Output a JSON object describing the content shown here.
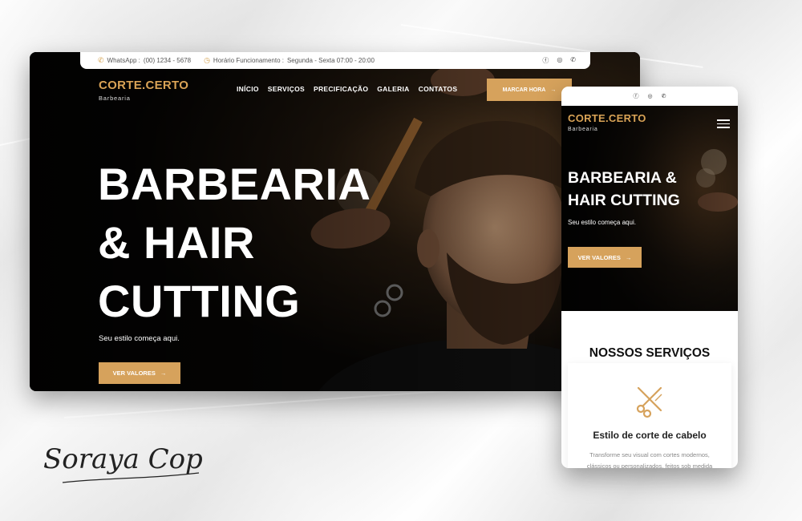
{
  "colors": {
    "gold": "#d6a25c",
    "dark": "#0d0b08",
    "white": "#ffffff"
  },
  "topbar": {
    "whatsapp_label": "WhatsApp :",
    "whatsapp_number": "(00) 1234 - 5678",
    "hours_label": "Horário Funcionamento :",
    "hours_value": "Segunda - Sexta 07:00 - 20:00",
    "icons": [
      "phone-icon",
      "clock-icon",
      "facebook-icon",
      "instagram-icon",
      "whatsapp-icon"
    ]
  },
  "brand": {
    "name": "CORTE.CERTO",
    "tagline": "Barbearia"
  },
  "nav": {
    "items": [
      "INÍCIO",
      "SERVIÇOS",
      "PRECIFICAÇÃO",
      "GALERIA",
      "CONTATOS"
    ]
  },
  "cta_top": {
    "label": "MARCAR HORA"
  },
  "hero": {
    "line1": "BARBEARIA",
    "line2": "& HAIR",
    "line3": "CUTTING",
    "subtitle": "Seu estilo começa aqui.",
    "button": "VER VALORES",
    "arrow": "→"
  },
  "mobile": {
    "hero_line1": "BARBEARIA &",
    "hero_line2": "HAIR CUTTING",
    "services_title": "NOSSOS SERVIÇOS",
    "card_title": "Estilo de corte de cabelo",
    "card_text_line1": "Transforme seu visual com cortes modernos,",
    "card_text_line2": "clássicos ou personalizados, feitos sob medida"
  },
  "signature": {
    "text": "Soraya Cop"
  }
}
